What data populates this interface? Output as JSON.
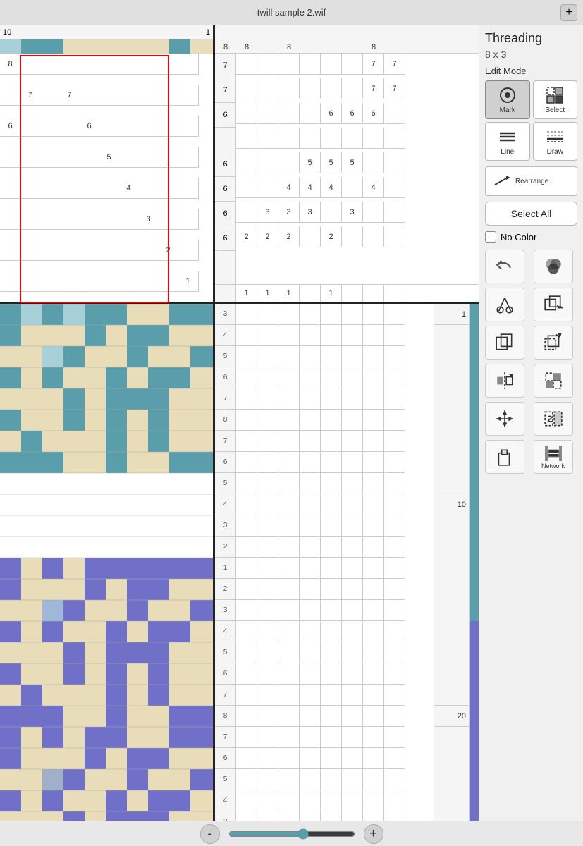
{
  "titlebar": {
    "title": "twill sample 2.wif",
    "plus_label": "+"
  },
  "panel": {
    "title": "Threading",
    "subtitle": "8 x 3",
    "edit_mode_label": "Edit Mode",
    "modes": [
      {
        "id": "mark",
        "label": "Mark",
        "icon": "⊙"
      },
      {
        "id": "select",
        "label": "Select",
        "icon": "▦"
      },
      {
        "id": "line",
        "label": "Line",
        "icon": "≡"
      },
      {
        "id": "draw",
        "label": "Draw",
        "icon": "≋"
      },
      {
        "id": "rearrange",
        "label": "Rearrange",
        "icon": "↗"
      }
    ],
    "select_all_label": "Select All",
    "no_color_label": "No Color",
    "icons": [
      {
        "id": "undo",
        "label": ""
      },
      {
        "id": "color-mix",
        "label": ""
      },
      {
        "id": "cut",
        "label": ""
      },
      {
        "id": "copy-transform",
        "label": ""
      },
      {
        "id": "copy",
        "label": ""
      },
      {
        "id": "paste-transform",
        "label": ""
      },
      {
        "id": "paste",
        "label": ""
      },
      {
        "id": "flip",
        "label": ""
      },
      {
        "id": "flip-h",
        "label": ""
      },
      {
        "id": "flip-v",
        "label": ""
      },
      {
        "id": "step-repeat",
        "label": ""
      },
      {
        "id": "network2",
        "label": "Network"
      }
    ]
  },
  "zoom": {
    "minus_label": "-",
    "plus_label": "+",
    "value": 60
  },
  "numbers": {
    "top_left": "10",
    "top_right": "1",
    "row_labels_left": [
      8,
      7,
      6,
      5,
      4,
      3,
      2,
      1
    ],
    "row_labels_right_treadle": [
      1,
      10,
      20
    ]
  },
  "colors": {
    "teal": "#5a9eab",
    "light_teal": "#a8d0d8",
    "cream": "#e8ddb8",
    "blue_purple": "#7070c8",
    "light_blue": "#a0c0d8"
  }
}
